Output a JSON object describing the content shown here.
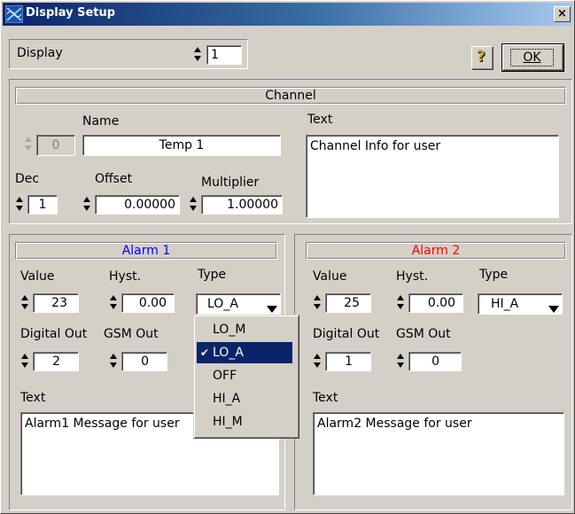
{
  "window": {
    "title": "Display Setup",
    "close_label": "×"
  },
  "toolbar": {
    "display_label": "Display",
    "display_value": "1",
    "help_label": "?",
    "ok_label": "OK"
  },
  "channel": {
    "header": "Channel",
    "name_label": "Name",
    "name_value": "Temp 1",
    "index_value": "0",
    "text_label": "Text",
    "text_value": "Channel Info for user",
    "dec_label": "Dec",
    "dec_value": "1",
    "offset_label": "Offset",
    "offset_value": "0.00000",
    "multiplier_label": "Multiplier",
    "multiplier_value": "1.00000"
  },
  "alarm1": {
    "header": "Alarm 1",
    "header_color": "#0000ff",
    "value_label": "Value",
    "value": "23",
    "hyst_label": "Hyst.",
    "hyst": "0.00",
    "type_label": "Type",
    "type": "LO_A",
    "digital_out_label": "Digital Out",
    "digital_out": "2",
    "gsm_out_label": "GSM Out",
    "gsm_out": "0",
    "text_label": "Text",
    "text_value": "Alarm1 Message for user"
  },
  "alarm2": {
    "header": "Alarm 2",
    "header_color": "#ff0000",
    "value_label": "Value",
    "value": "25",
    "hyst_label": "Hyst.",
    "hyst": "0.00",
    "type_label": "Type",
    "type": "HI_A",
    "digital_out_label": "Digital Out",
    "digital_out": "1",
    "gsm_out_label": "GSM Out",
    "gsm_out": "0",
    "text_label": "Text",
    "text_value": "Alarm2 Message for user"
  },
  "type_menu": {
    "options": [
      "LO_M",
      "LO_A",
      "OFF",
      "HI_A",
      "HI_M"
    ],
    "selected": "LO_A",
    "check_mark": "✔"
  }
}
